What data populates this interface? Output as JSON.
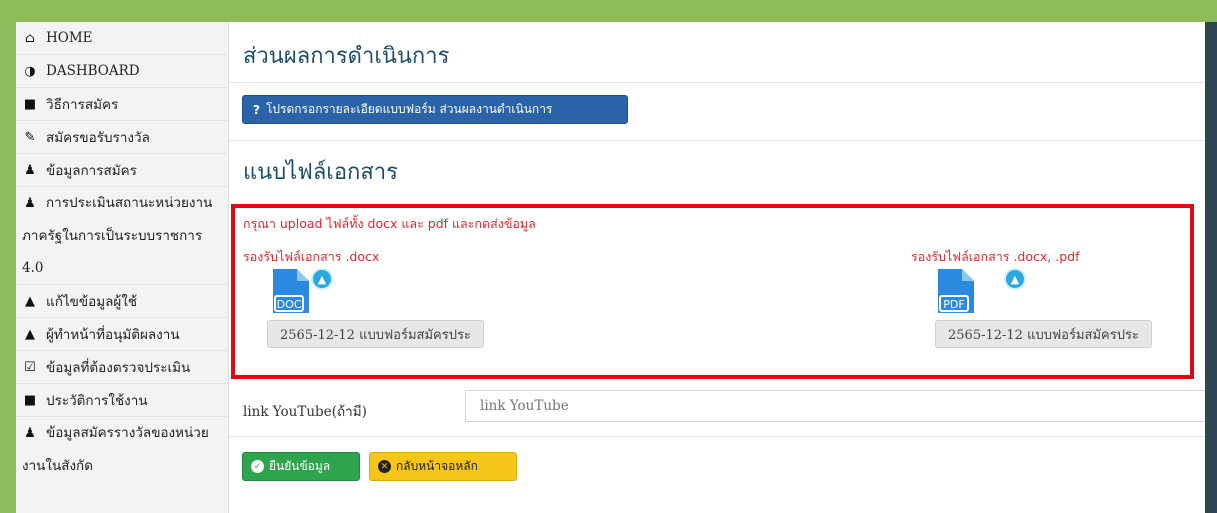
{
  "sidebar": {
    "items": [
      {
        "icon": "home-icon",
        "glyph": "⌂",
        "label": "HOME"
      },
      {
        "icon": "dashboard-icon",
        "glyph": "◑",
        "label": "DASHBOARD"
      },
      {
        "icon": "file-icon",
        "glyph": "■",
        "label": "วิธีการสมัคร"
      },
      {
        "icon": "pencil-icon",
        "glyph": "✎",
        "label": "สมัครขอรับรางวัล"
      },
      {
        "icon": "users-icon",
        "glyph": "♟",
        "label": "ข้อมูลการสมัคร"
      },
      {
        "icon": "users-icon",
        "glyph": "♟",
        "label": "การประเมินสถานะหน่วยงานภาครัฐในการเป็นระบบราชการ 4.0"
      },
      {
        "icon": "user-icon",
        "glyph": "▲",
        "label": "แก้ไขข้อมูลผู้ใช้"
      },
      {
        "icon": "user-icon",
        "glyph": "▲",
        "label": "ผู้ทำหน้าที่อนุมัติผลงาน"
      },
      {
        "icon": "checkbox-icon",
        "glyph": "☑",
        "label": "ข้อมูลที่ต้องตรวจประเมิน"
      },
      {
        "icon": "book-icon",
        "glyph": "■",
        "label": "ประวัติการใช้งาน"
      },
      {
        "icon": "users-icon",
        "glyph": "♟",
        "label": "ข้อมูลสมัครรางวัลของหน่วยงานในสังกัด"
      }
    ]
  },
  "main": {
    "title": "ส่วนผลการดำเนินการ",
    "info_button": "โปรดกรอกรายละเอียดแบบฟอร์ม ส่วนผลงานดำเนินการ",
    "attach_title": "แนบไฟล์เอกสาร",
    "upload_note": "กรุณา upload ไฟล์ทั้ง docx และ pdf และกดส่งข้อมูล",
    "doc_block": {
      "hint": "รองรับไฟล์เอกสาร .docx",
      "icon_label": "DOC",
      "file_name": "2565-12-12 แบบฟอร์มสมัครประ"
    },
    "pdf_block": {
      "hint": "รองรับไฟล์เอกสาร .docx, .pdf",
      "icon_label": "PDF",
      "file_name": "2565-12-12 แบบฟอร์มสมัครประ"
    },
    "youtube_label": "link YouTube(ถ้ามี)",
    "youtube_placeholder": "link YouTube",
    "confirm_button": "ยืนยันข้อมูล",
    "back_button": "กลับหน้าจอหลัก"
  },
  "colors": {
    "accent_blue": "#2b63a8",
    "alert_red": "#e30613",
    "success_green": "#2ea44f",
    "warning_yellow": "#f5c518",
    "frame_green": "#8fbc5a"
  }
}
